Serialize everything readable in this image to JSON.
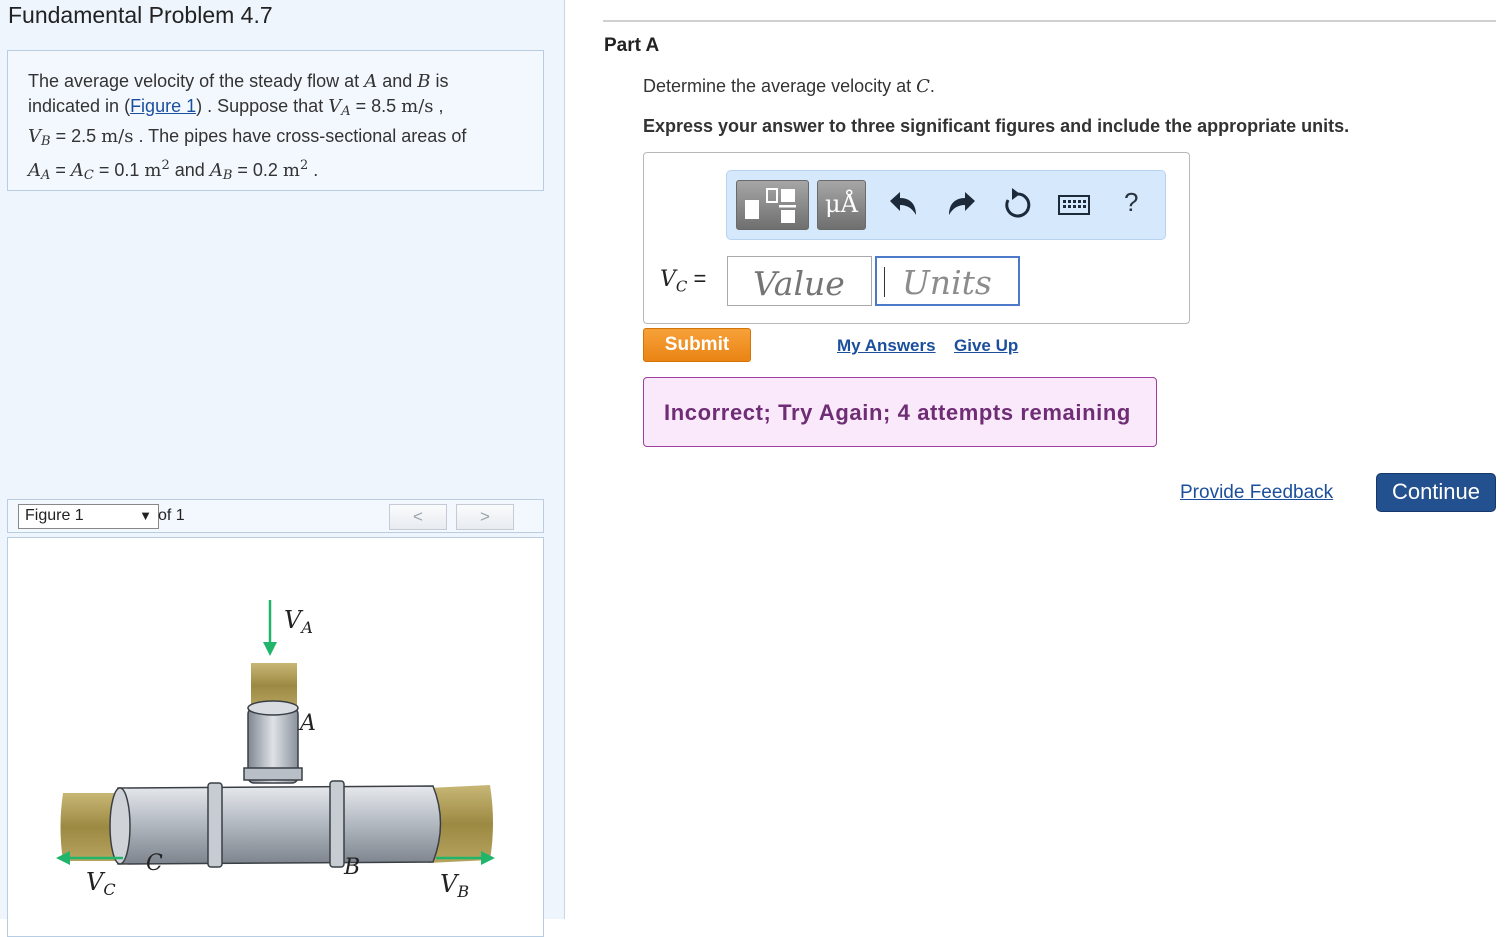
{
  "problem": {
    "title": "Fundamental Problem 4.7",
    "t1": "The average velocity of the steady flow at ",
    "var_A": "A",
    "t2": " and ",
    "var_B": "B",
    "t3": " is",
    "t4": "indicated in (",
    "figure_link": "Figure 1",
    "t5": ") . Suppose that ",
    "VA_var": "V",
    "VA_sub": "A",
    "VA_value": " = 8.5 ",
    "VA_unit": "m/s",
    "t6": " ,",
    "VB_var": "V",
    "VB_sub": "B",
    "VB_value": " = 2.5 ",
    "VB_unit": "m/s",
    "t7": " . The pipes have cross-sectional areas of",
    "AA_var": "A",
    "AA_sub": "A",
    "eq": " = ",
    "AC_var": "A",
    "AC_sub": "C",
    "AAC_value": " = 0.1 ",
    "unit_m": "m",
    "sq": "2",
    "t8": " and ",
    "AB_var": "A",
    "AB_sub": "B",
    "AB_value": " = 0.2 ",
    "t9": " ."
  },
  "figure_nav": {
    "select_value": "Figure 1",
    "of_text": "of 1",
    "prev_symbol": "<",
    "next_symbol": ">"
  },
  "figure_labels": {
    "VA": "V",
    "VA_sub": "A",
    "A": "A",
    "C": "C",
    "B": "B",
    "VC": "V",
    "VC_sub": "C",
    "VB": "V",
    "VB_sub": "B"
  },
  "part": {
    "title": "Part A",
    "q1": "Determine the average velocity at ",
    "q_var": "C",
    "q2": ".",
    "instruction": "Express your answer to three significant figures and include the appropriate units."
  },
  "answer": {
    "label_var": "V",
    "label_sub": "C",
    "label_eq": " =",
    "value_placeholder": "Value",
    "units_placeholder": "Units",
    "units_symbol": "μÅ",
    "help_symbol": "?"
  },
  "icons": {
    "templates": "templates-icon",
    "units": "units-icon",
    "undo": "undo-icon",
    "redo": "redo-icon",
    "reset": "reset-icon",
    "keyboard": "keyboard-icon",
    "help": "help-icon"
  },
  "actions": {
    "submit": "Submit",
    "my_answers": "My Answers",
    "give_up": "Give Up",
    "provide_feedback": "Provide Feedback",
    "continue": "Continue"
  },
  "feedback": {
    "message": "Incorrect; Try Again; 4 attempts remaining"
  },
  "colors": {
    "panel_bg": "#eef5fd",
    "link": "#1b4f9c",
    "submit": "#f08f22",
    "continue": "#23508e",
    "feedback_bg": "#fae8fb",
    "feedback_text": "#6e2d74",
    "arrow_green": "#21b56b"
  }
}
